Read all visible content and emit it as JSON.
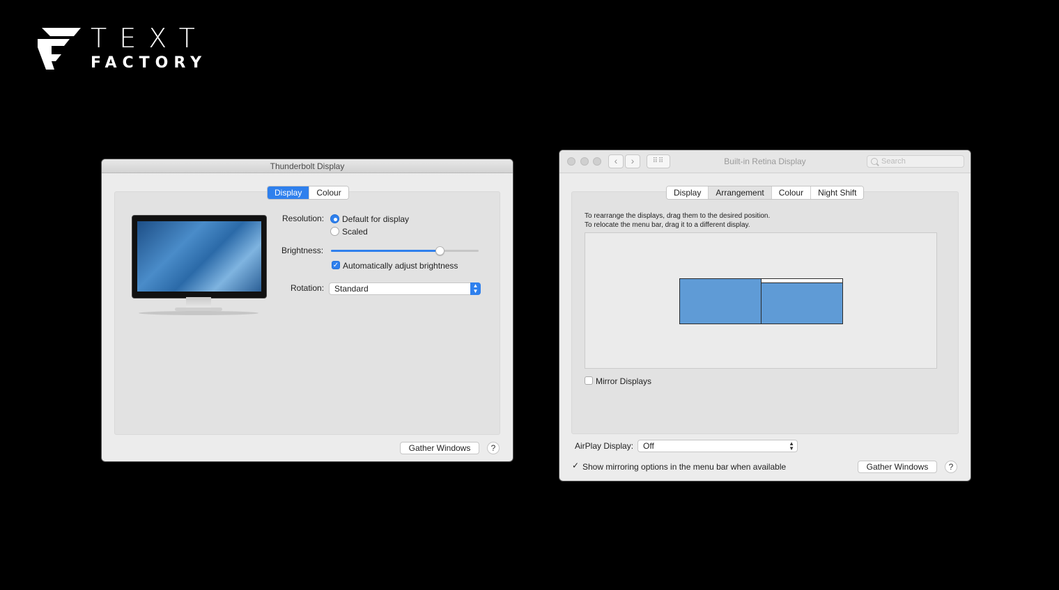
{
  "logo": {
    "line1": "TEXT",
    "line2": "FACTORY"
  },
  "left_window": {
    "title": "Thunderbolt Display",
    "tabs": [
      {
        "label": "Display",
        "selected": true
      },
      {
        "label": "Colour",
        "selected": false
      }
    ],
    "resolution": {
      "label": "Resolution:",
      "options": [
        {
          "label": "Default for display",
          "selected": true
        },
        {
          "label": "Scaled",
          "selected": false
        }
      ]
    },
    "brightness": {
      "label": "Brightness:",
      "level": 0.73
    },
    "auto_brightness": {
      "label": "Automatically adjust brightness",
      "checked": true
    },
    "rotation": {
      "label": "Rotation:",
      "value": "Standard"
    },
    "gather_button": "Gather Windows",
    "help_label": "?"
  },
  "right_window": {
    "title": "Built-in Retina Display",
    "search_placeholder": "Search",
    "tabs": [
      {
        "label": "Display",
        "selected": false
      },
      {
        "label": "Arrangement",
        "selected": true
      },
      {
        "label": "Colour",
        "selected": false
      },
      {
        "label": "Night Shift",
        "selected": false
      }
    ],
    "instructions": [
      "To rearrange the displays, drag them to the desired position.",
      "To relocate the menu bar, drag it to a different display."
    ],
    "mirror_displays": {
      "label": "Mirror Displays",
      "checked": false
    },
    "airplay": {
      "label": "AirPlay Display:",
      "value": "Off"
    },
    "show_mirroring": {
      "label": "Show mirroring options in the menu bar when available",
      "checked": true
    },
    "gather_button": "Gather Windows",
    "help_label": "?"
  },
  "colors": {
    "accent": "#2f80ed",
    "display_blue": "#5f9bd6",
    "background": "#000000"
  }
}
